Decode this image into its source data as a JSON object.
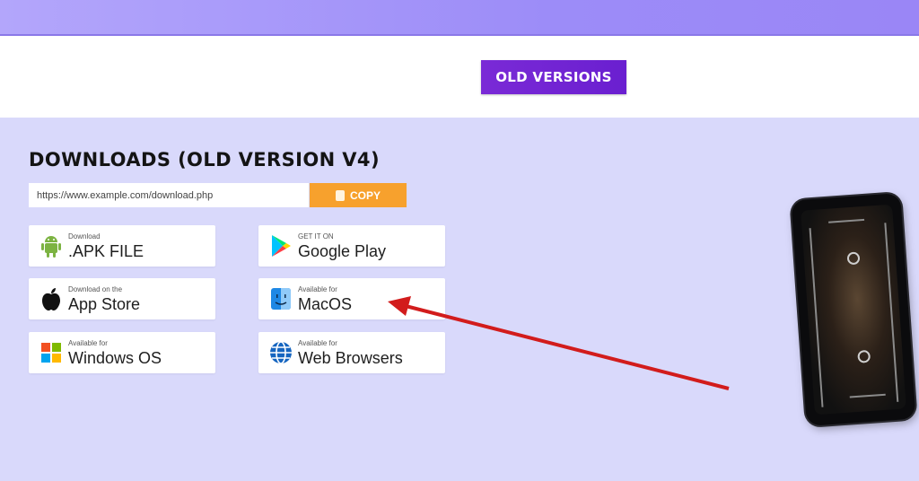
{
  "header": {
    "old_versions_label": "OLD VERSIONS"
  },
  "downloads": {
    "title": "DOWNLOADS (OLD VERSION V4)",
    "url_text": "https://www.example.com/download.php",
    "copy_label": "COPY",
    "buttons": [
      {
        "small": "Download",
        "label": ".APK FILE",
        "icon": "android-icon"
      },
      {
        "small": "GET IT ON",
        "label": "Google Play",
        "icon": "google-play-icon"
      },
      {
        "small": "Download on the",
        "label": "App Store",
        "icon": "apple-icon"
      },
      {
        "small": "Available for",
        "label": "MacOS",
        "icon": "finder-icon"
      },
      {
        "small": "Available for",
        "label": "Windows OS",
        "icon": "windows-icon"
      },
      {
        "small": "Available for",
        "label": "Web Browsers",
        "icon": "globe-icon"
      }
    ]
  },
  "colors": {
    "accent": "#7a2ad6",
    "copy": "#f7a12d",
    "arrow": "#d21c1c"
  }
}
